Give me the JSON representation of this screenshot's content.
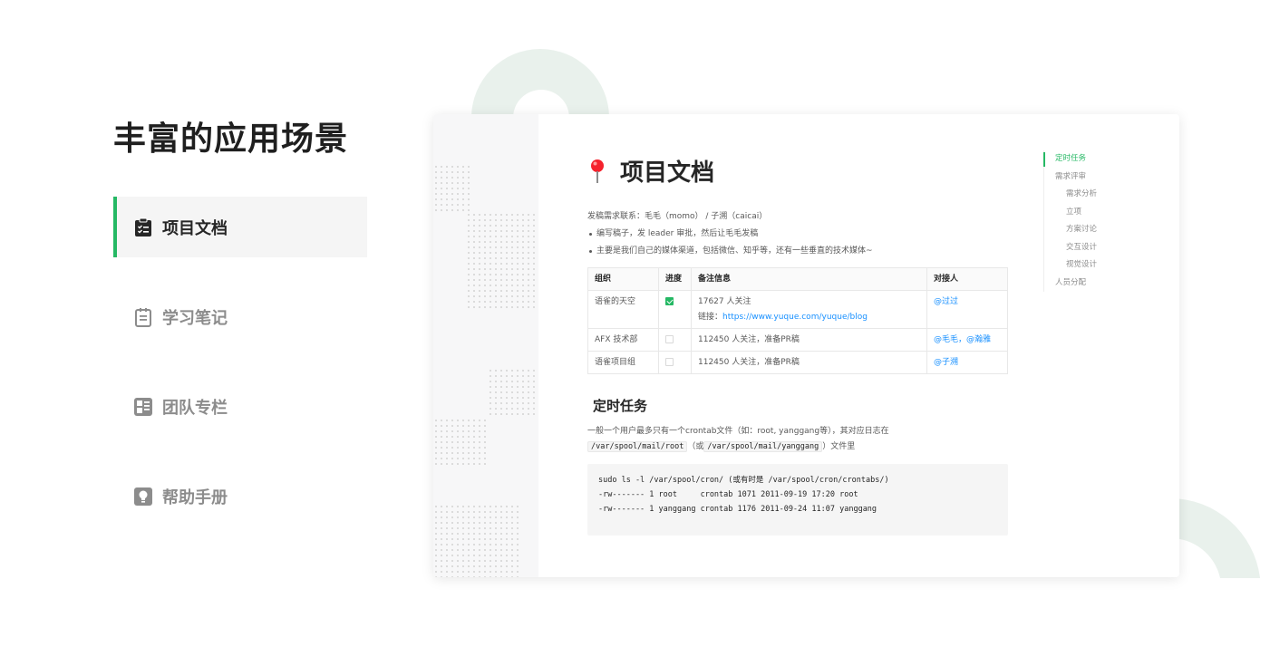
{
  "headline": "丰富的应用场景",
  "menu": [
    {
      "label": "项目文档",
      "icon": "clipboard-list-icon",
      "active": true
    },
    {
      "label": "学习笔记",
      "icon": "notebook-icon",
      "active": false
    },
    {
      "label": "团队专栏",
      "icon": "layout-grid-icon",
      "active": false
    },
    {
      "label": "帮助手册",
      "icon": "lightbulb-icon",
      "active": false
    }
  ],
  "doc": {
    "title": "项目文档",
    "title_icon": "pin-icon",
    "intro": "发稿需求联系：毛毛（momo） / 子溯（caicai）",
    "bullets": [
      "编写稿子，发 leader 审批，然后让毛毛发稿",
      "主要是我们自己的媒体渠道，包括微信、知乎等，还有一些垂直的技术媒体~"
    ],
    "table": {
      "headers": [
        "组织",
        "进度",
        "备注信息",
        "对接人"
      ],
      "rows": [
        {
          "org": "语雀的天空",
          "done": true,
          "note1": "17627 人关注",
          "note2_prefix": "链接：",
          "note2_link": "https://www.yuque.com/yuque/blog",
          "contact": "@过过"
        },
        {
          "org": "AFX 技术部",
          "done": false,
          "note1": "112450 人关注，准备PR稿",
          "note2_prefix": "",
          "note2_link": "",
          "contact": "@毛毛，@瀚雅"
        },
        {
          "org": "语雀项目组",
          "done": false,
          "note1": "112450 人关注，准备PR稿",
          "note2_prefix": "",
          "note2_link": "",
          "contact": "@子溯"
        }
      ]
    },
    "section_title": "定时任务",
    "para_line1": "一般一个用户最多只有一个crontab文件（如：root, yanggang等），其对应日志在",
    "para_code1": "/var/spool/mail/root",
    "para_mid": "（或",
    "para_code2": "/var/spool/mail/yanggang",
    "para_end": "）文件里",
    "code_lines": [
      "sudo ls -l /var/spool/cron/ (或有时是 /var/spool/cron/crontabs/)",
      "-rw------- 1 root     crontab 1071 2011-09-19 17:20 root",
      "-rw------- 1 yanggang crontab 1176 2011-09-24 11:07 yanggang"
    ]
  },
  "toc": [
    {
      "label": "定时任务",
      "level": 1,
      "active": true
    },
    {
      "label": "需求评审",
      "level": 1,
      "active": false
    },
    {
      "label": "需求分析",
      "level": 2,
      "active": false
    },
    {
      "label": "立项",
      "level": 2,
      "active": false
    },
    {
      "label": "方案讨论",
      "level": 2,
      "active": false
    },
    {
      "label": "交互设计",
      "level": 2,
      "active": false
    },
    {
      "label": "视觉设计",
      "level": 2,
      "active": false
    },
    {
      "label": "人员分配",
      "level": 1,
      "active": false
    }
  ],
  "colors": {
    "accent": "#25b864",
    "link": "#1890ff",
    "deco": "#e9f1ec"
  }
}
